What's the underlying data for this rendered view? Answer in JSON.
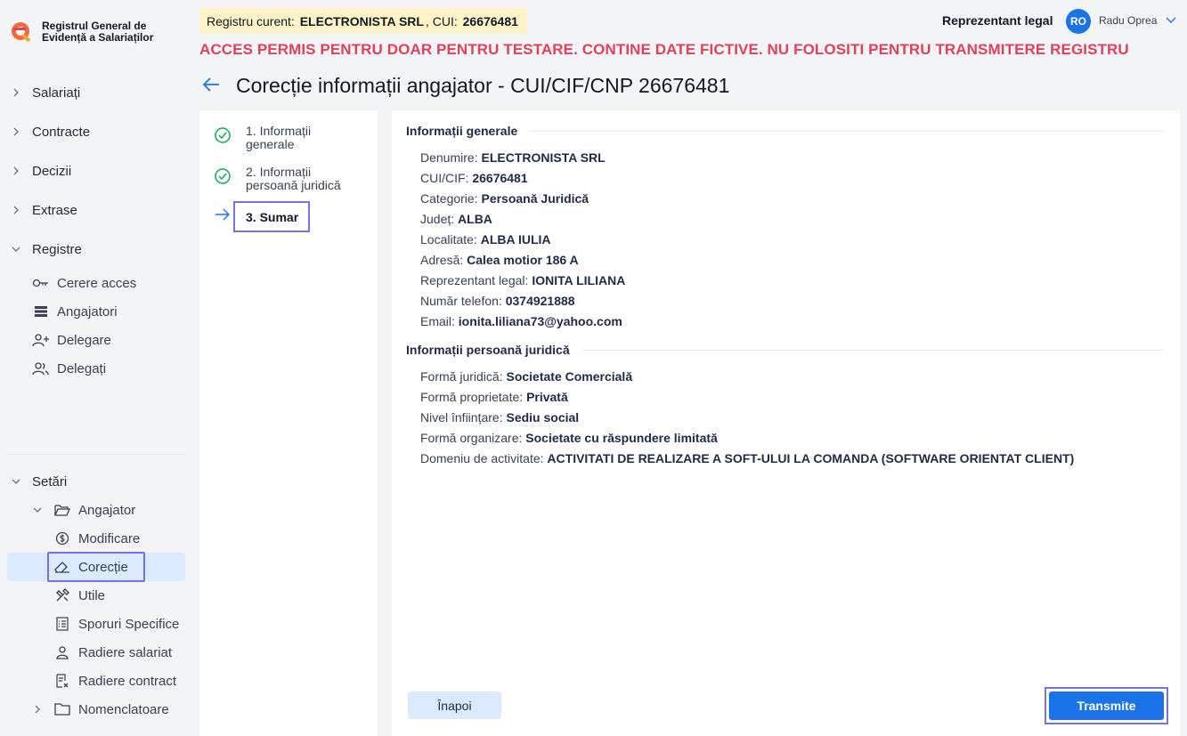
{
  "app": {
    "logo_line1": "Registrul General de",
    "logo_line2": "Evidență a Salariaților"
  },
  "header": {
    "registry_prefix": "Registru curent:",
    "registry_company": "ELECTRONISTA SRL",
    "registry_cui_label": ", CUI:",
    "registry_cui": "26676481",
    "role": "Reprezentant legal",
    "avatar_initials": "RO",
    "user_name": "Radu Oprea",
    "warning": "ACCES PERMIS PENTRU DOAR PENTRU TESTARE. CONTINE DATE FICTIVE. NU FOLOSITI PENTRU TRANSMITERE REGISTRU"
  },
  "page": {
    "title": "Corecție informații angajator - CUI/CIF/CNP 26676481"
  },
  "sidebar": {
    "top": [
      "Salariați",
      "Contracte",
      "Decizii",
      "Extrase"
    ],
    "registre_label": "Registre",
    "registre_items": [
      "Cerere acces",
      "Angajatori",
      "Delegare",
      "Delegați"
    ],
    "setari_label": "Setări",
    "angajator_label": "Angajator",
    "angajator_items": [
      "Modificare",
      "Corecție",
      "Utile",
      "Sporuri Specifice",
      "Radiere salariat",
      "Radiere contract"
    ],
    "nomenclatoare_label": "Nomenclatoare"
  },
  "steps": {
    "step1": "1. Informații generale",
    "step2": "2. Informații persoană juridică",
    "step3": "3. Sumar"
  },
  "general": {
    "heading": "Informații generale",
    "fields": [
      {
        "label": "Denumire:",
        "value": "ELECTRONISTA SRL"
      },
      {
        "label": "CUI/CIF:",
        "value": "26676481"
      },
      {
        "label": "Categorie:",
        "value": "Persoană Juridică"
      },
      {
        "label": "Județ:",
        "value": "ALBA"
      },
      {
        "label": "Localitate:",
        "value": "ALBA IULIA"
      },
      {
        "label": "Adresă:",
        "value": "Calea motior 186 A"
      },
      {
        "label": "Reprezentant legal:",
        "value": "IONITA LILIANA"
      },
      {
        "label": "Număr telefon:",
        "value": "0374921888"
      },
      {
        "label": "Email:",
        "value": "ionita.liliana73@yahoo.com"
      }
    ]
  },
  "legal": {
    "heading": "Informații persoană juridică",
    "fields": [
      {
        "label": "Formă juridică:",
        "value": "Societate Comercială"
      },
      {
        "label": "Formă proprietate:",
        "value": "Privată"
      },
      {
        "label": "Nivel înființare:",
        "value": "Sediu social"
      },
      {
        "label": "Formă organizare:",
        "value": "Societate cu răspundere limitată"
      },
      {
        "label": "Domeniu de activitate:",
        "value": "ACTIVITATI DE REALIZARE A SOFT-ULUI LA COMANDA (SOFTWARE ORIENTAT CLIENT)"
      }
    ]
  },
  "actions": {
    "back": "Înapoi",
    "submit": "Transmite"
  }
}
